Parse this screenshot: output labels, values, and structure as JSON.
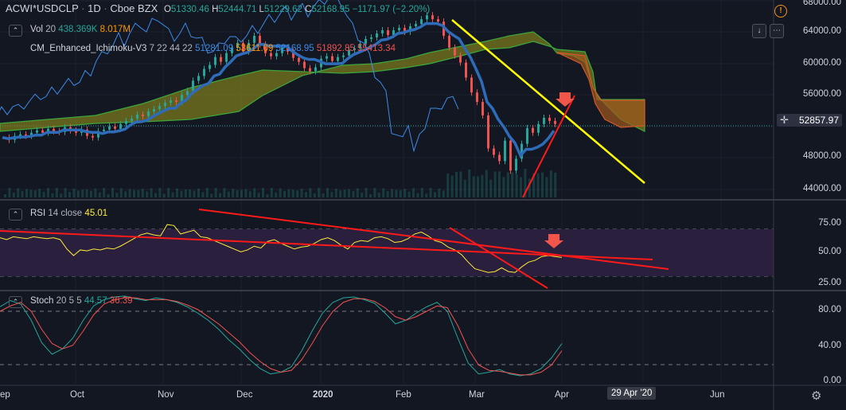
{
  "header": {
    "symbol": "ACWI*USDCLP",
    "interval": "1D",
    "exchange": "Cboe BZX",
    "o_label": "O",
    "o": "51330.46",
    "h_label": "H",
    "h": "52444.71",
    "l_label": "L",
    "l": "51229.62",
    "c_label": "C",
    "c": "52168.95",
    "change": "−1171.97 (−2.20%)",
    "alert_icon": "info-icon"
  },
  "indicators": {
    "vol": {
      "name": "Vol",
      "period": "20",
      "v1": "438.369K",
      "v2": "8.017M"
    },
    "ichimoku": {
      "name": "CM_Enhanced_Ichimoku-V3",
      "params": "7 22 44 22",
      "v1": "51281.09",
      "v2": "53611.09",
      "v3": "52168.95",
      "v4": "51892.85",
      "v5": "55413.34"
    },
    "rsi": {
      "name": "RSI",
      "params": "14 close",
      "value": "45.01"
    },
    "stoch": {
      "name": "Stoch",
      "params": "20 5 5",
      "k": "44.57",
      "d": "36.39"
    }
  },
  "price_axis": [
    "68000.00",
    "64000.00",
    "60000.00",
    "56000.00",
    "52000.00",
    "48000.00",
    "44000.00"
  ],
  "price_label": "52857.97",
  "rsi_axis": [
    "75.00",
    "50.00",
    "25.00"
  ],
  "stoch_axis": [
    "80.00",
    "40.00",
    "0.00"
  ],
  "x_axis": [
    "ep",
    "Oct",
    "Nov",
    "Dec",
    "2020",
    "Feb",
    "Mar",
    "Apr",
    "Jun"
  ],
  "date_label": "29 Apr '20",
  "colors": {
    "bg": "#131722",
    "up": "#26a69a",
    "down": "#ef5350",
    "trend_yellow": "#ffff00",
    "trend_red": "#ff1a1a",
    "kijun": "#2e6bb8",
    "tenkan": "#3d8be8",
    "cloud": "#7b7a1e",
    "rsi_band": "#2a1f3d",
    "arrow": "#f2554a"
  },
  "chart_data": [
    {
      "type": "candlestick",
      "pane": "price",
      "ylim": [
        43000,
        68500
      ],
      "close_series": [
        50600,
        50300,
        50800,
        51000,
        50800,
        51200,
        51500,
        51200,
        51700,
        51400,
        51300,
        51900,
        51500,
        51200,
        51600,
        50800,
        50600,
        51400,
        51600,
        52000,
        51700,
        52300,
        52700,
        53000,
        53500,
        53300,
        53900,
        54200,
        54600,
        55000,
        55300,
        55100,
        56000,
        56500,
        57800,
        58400,
        59300,
        59800,
        60800,
        60200,
        61300,
        62000,
        62600,
        61500,
        62600,
        63500,
        62400,
        61300,
        60900,
        61300,
        62000,
        61500,
        60700,
        60200,
        59400,
        59000,
        59500,
        60600,
        60900,
        60300,
        60800,
        61000,
        61700,
        61900,
        62500,
        63100,
        63300,
        63800,
        64200,
        63600,
        64200,
        64500,
        64000,
        64700,
        65000,
        65600,
        66100,
        65600,
        65300,
        63500,
        62000,
        61000,
        60100,
        58200,
        56300,
        55100,
        53400,
        49200,
        48400,
        47600,
        50200,
        46400,
        47900,
        49800,
        51800,
        51200,
        52300,
        53100,
        52700,
        52300
      ],
      "title": "ACWI*USDCLP"
    },
    {
      "type": "line",
      "pane": "rsi",
      "ylim": [
        25,
        75
      ],
      "series": [
        {
          "name": "RSI",
          "values": [
            66,
            64,
            67,
            66,
            65,
            67,
            66,
            65,
            66,
            64,
            54,
            47,
            53,
            52,
            54,
            53,
            55,
            54,
            57,
            61,
            65,
            69,
            71,
            69,
            68,
            80,
            79,
            70,
            72,
            74,
            67,
            66,
            63,
            60,
            57,
            54,
            51,
            53,
            57,
            55,
            62,
            64,
            60,
            57,
            54,
            56,
            57,
            60,
            64,
            66,
            63,
            58,
            54,
            61,
            63,
            62,
            66,
            67,
            65,
            61,
            62,
            65,
            70,
            72,
            68,
            63,
            61,
            56,
            53,
            48,
            40,
            33,
            31,
            29,
            30,
            34,
            30,
            29,
            35,
            40,
            42,
            46,
            47,
            46,
            45
          ]
        }
      ]
    },
    {
      "type": "line",
      "pane": "stoch",
      "ylim": [
        0,
        100
      ],
      "series": [
        {
          "name": "%K",
          "values": [
            85,
            92,
            88,
            70,
            45,
            32,
            38,
            50,
            70,
            86,
            93,
            96,
            97,
            94,
            92,
            95,
            93,
            90,
            85,
            78,
            70,
            60,
            48,
            38,
            26,
            16,
            10,
            12,
            18,
            36,
            58,
            78,
            90,
            95,
            96,
            93,
            89,
            78,
            66,
            70,
            78,
            85,
            90,
            80,
            50,
            22,
            10,
            12,
            15,
            10,
            8,
            10,
            16,
            28,
            44
          ]
        },
        {
          "name": "%D",
          "values": [
            80,
            86,
            90,
            80,
            60,
            44,
            38,
            42,
            58,
            76,
            88,
            93,
            95,
            95,
            93,
            93,
            93,
            91,
            87,
            82,
            74,
            66,
            56,
            46,
            34,
            24,
            16,
            12,
            14,
            26,
            44,
            64,
            80,
            90,
            94,
            94,
            91,
            84,
            74,
            70,
            74,
            80,
            86,
            84,
            64,
            38,
            20,
            14,
            13,
            11,
            9,
            9,
            12,
            20,
            36
          ]
        }
      ]
    }
  ]
}
